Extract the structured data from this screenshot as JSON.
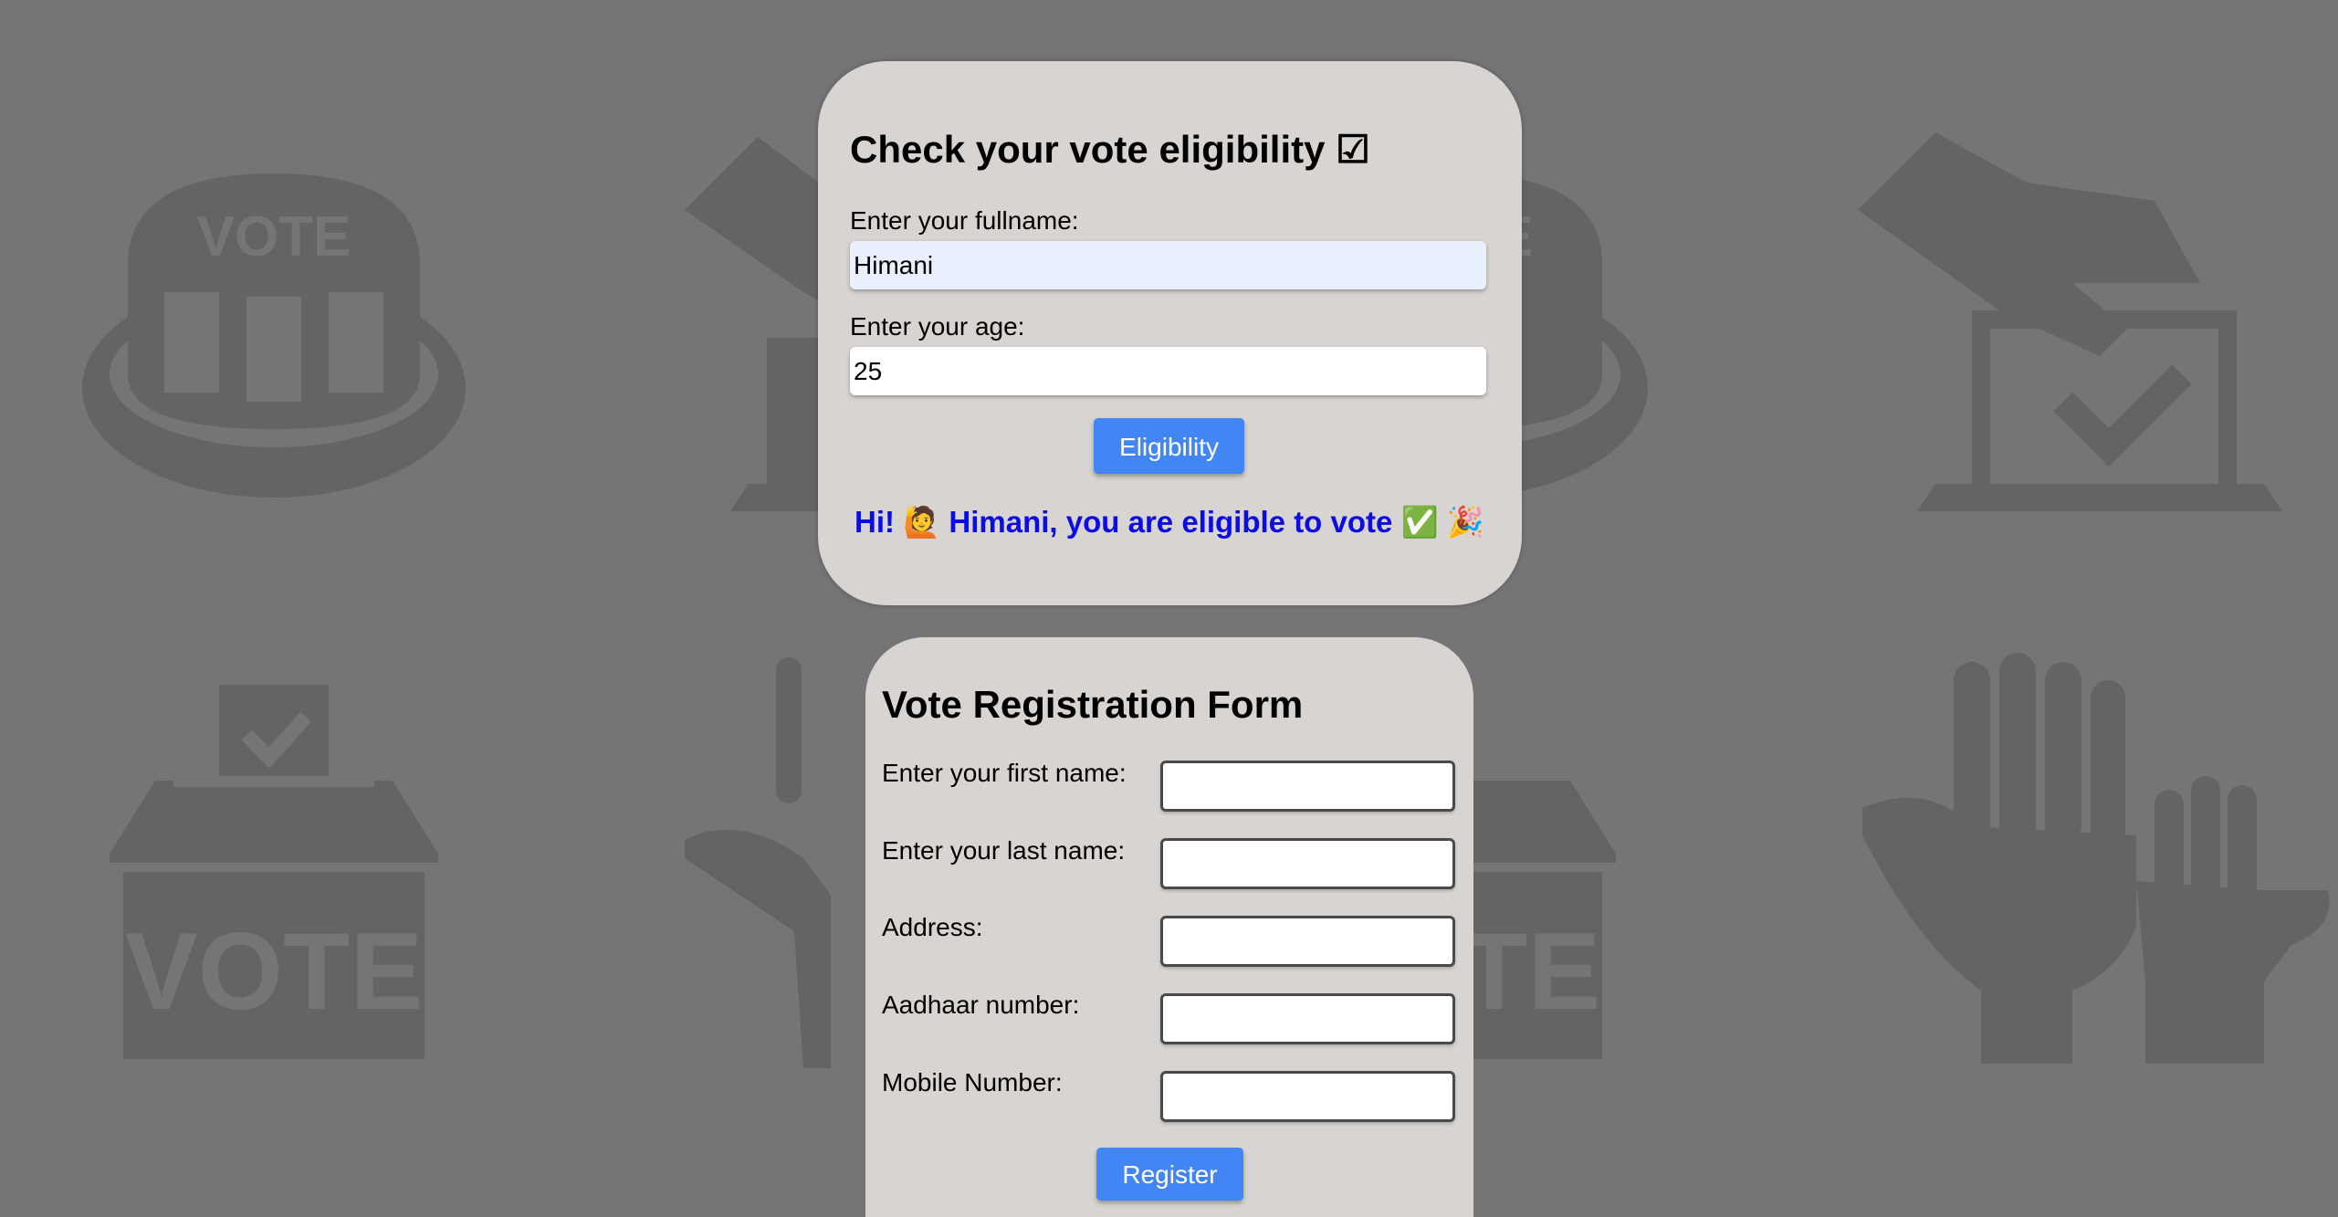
{
  "eligibility": {
    "title": "Check your vote eligibility ☑",
    "fullname_label": "Enter your fullname:",
    "fullname_value": "Himani",
    "age_label": "Enter your age:",
    "age_value": "25",
    "button_label": "Eligibility",
    "result_text": "Hi! 🙋 Himani, you are eligible to vote ✅ 🎉",
    "result_color": "#0b0be3"
  },
  "registration": {
    "title": "Vote Registration Form",
    "fields": [
      {
        "label": "Enter your first name:",
        "value": ""
      },
      {
        "label": "Enter your last name:",
        "value": ""
      },
      {
        "label": "Address:",
        "value": ""
      },
      {
        "label": "Aadhaar number:",
        "value": ""
      },
      {
        "label": "Mobile Number:",
        "value": ""
      }
    ],
    "button_label": "Register"
  },
  "colors": {
    "background": "#757577",
    "card": "#d7d4d1",
    "button": "#4285f4",
    "icon": "#646465"
  },
  "background_icons": [
    "vote-button-icon",
    "hand-ballot-icon",
    "vote-button-icon",
    "hand-ballot-icon",
    "ballot-box-icon",
    "raised-hands-icon",
    "ballot-box-icon",
    "raised-hands-icon"
  ]
}
